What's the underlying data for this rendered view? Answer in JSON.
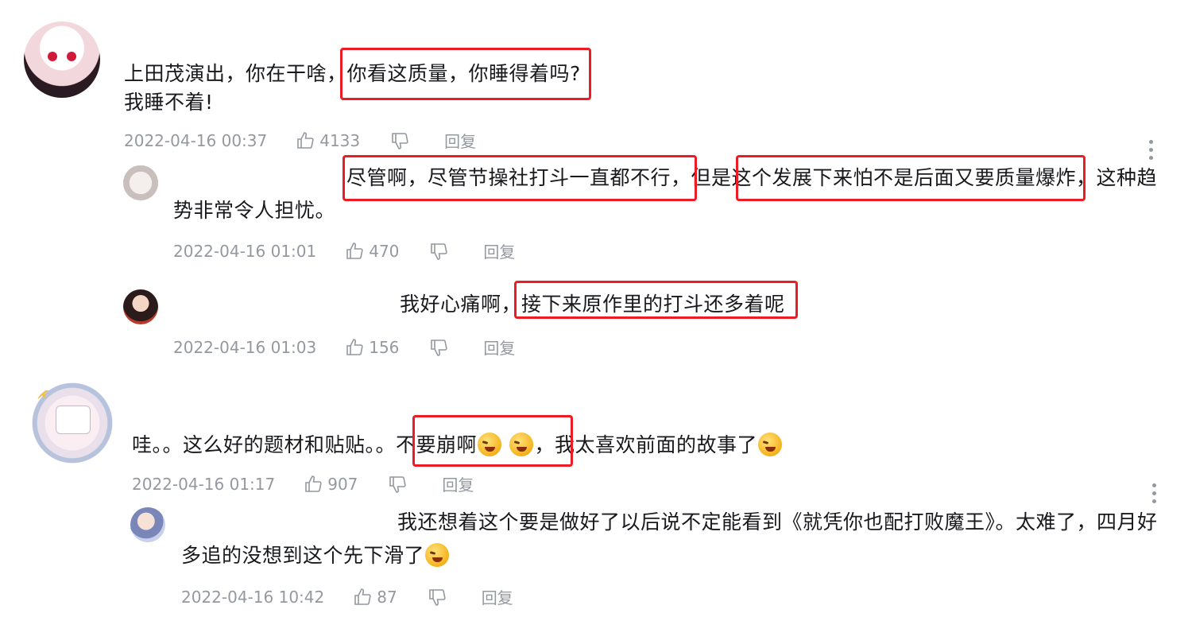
{
  "comments": [
    {
      "text": "上田茂演出，你在干啥，你看这质量，你睡得着吗?",
      "text_line2": "我睡不着!",
      "time": "2022-04-16 00:37",
      "likes": "4133",
      "reply_label": "回复",
      "replies": [
        {
          "text_line1": "尽管啊，尽管节操社打斗一直都不行，但是这个发展下来怕不是后面又要质量爆炸，这种趋",
          "text_line2": "势非常令人担忧。",
          "time": "2022-04-16 01:01",
          "likes": "470",
          "reply_label": "回复"
        },
        {
          "text_line1": "我好心痛啊，接下来原作里的打斗还多着呢",
          "time": "2022-04-16 01:03",
          "likes": "156",
          "reply_label": "回复"
        }
      ]
    },
    {
      "text_a": "哇。。这么好的题材和贴贴。。不要崩啊",
      "text_b": "，我太喜欢前面的故事了",
      "time": "2022-04-16 01:17",
      "likes": "907",
      "reply_label": "回复",
      "replies": [
        {
          "text_line1": "我还想着这个要是做好了以后说不定能看到《就凭你也配打败魔王》。太难了，四月好",
          "text_line2": "多追的没想到这个先下滑了",
          "time": "2022-04-16 10:42",
          "likes": "87",
          "reply_label": "回复"
        }
      ]
    }
  ],
  "icons": {
    "like": "thumbs-up-icon",
    "dislike": "thumbs-down-icon",
    "more": "more-vertical-icon",
    "emoji": "crying-laughing-emoji"
  },
  "colors": {
    "highlight_box": "#ec1c24",
    "meta_text": "#9499a0",
    "body_text": "#18191c"
  }
}
